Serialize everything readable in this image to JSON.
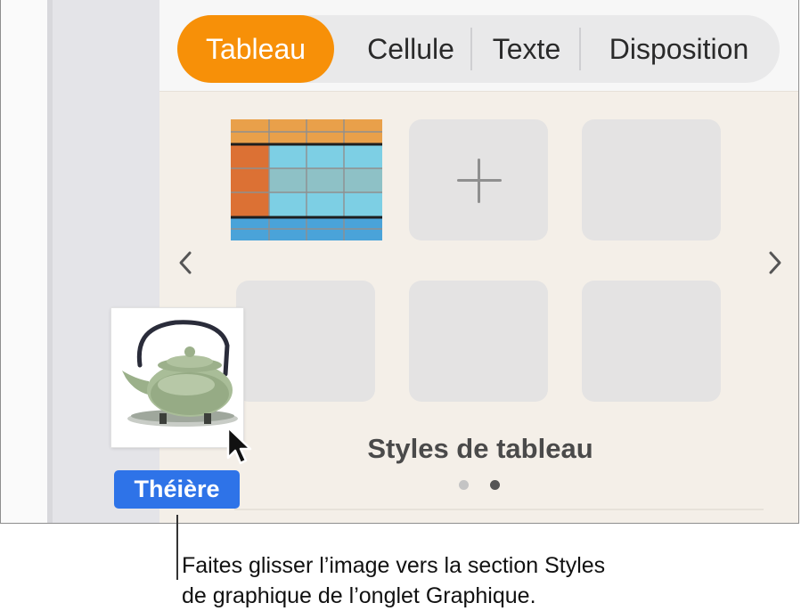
{
  "tabs": [
    {
      "label": "Tableau",
      "active": true
    },
    {
      "label": "Cellule",
      "active": false
    },
    {
      "label": "Texte",
      "active": false
    },
    {
      "label": "Disposition",
      "active": false
    }
  ],
  "panel": {
    "section_title": "Styles de tableau",
    "page_count": 2,
    "current_page": 2,
    "prev_icon": "chevron-left-icon",
    "next_icon": "chevron-right-icon",
    "add_icon": "plus-icon"
  },
  "drag": {
    "image_label": "Théière",
    "image_icon": "teapot-icon",
    "cursor_icon": "pointer-cursor-icon"
  },
  "callout": {
    "line1": "Faites glisser l’image vers la section Styles",
    "line2": "de graphique de l’onglet Graphique."
  },
  "colors": {
    "accent": "#f79008",
    "badge": "#2e73e8",
    "swatch_empty": "#e4e3e3",
    "table_header": "#e9a04a",
    "table_col": "#dc7134",
    "table_cell": "#7dcfe4",
    "table_footer": "#4aa3d9"
  }
}
